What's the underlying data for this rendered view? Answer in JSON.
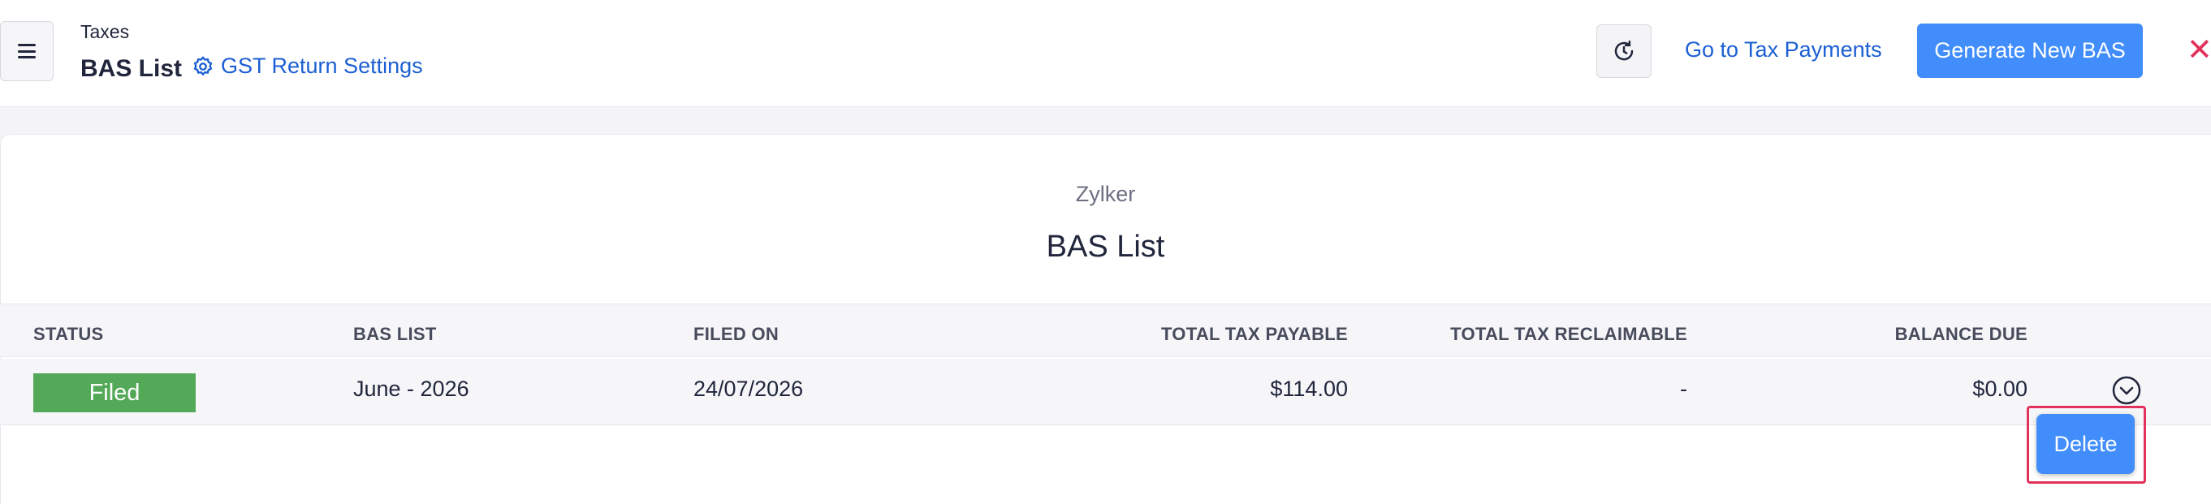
{
  "header": {
    "breadcrumb": "Taxes",
    "title": "BAS List",
    "settings_link": "GST Return Settings",
    "payments_link": "Go to Tax Payments",
    "generate_button": "Generate New BAS",
    "close_glyph": "✕",
    "icons": [
      "menu-icon",
      "gear-icon",
      "refresh-icon",
      "close-icon"
    ]
  },
  "report": {
    "organization": "Zylker",
    "title": "BAS List"
  },
  "table": {
    "columns": [
      "STATUS",
      "BAS LIST",
      "FILED ON",
      "TOTAL TAX PAYABLE",
      "TOTAL TAX RECLAIMABLE",
      "BALANCE DUE"
    ],
    "rows": [
      {
        "status": "Filed",
        "bas_list": "June - 2026",
        "filed_on": "24/07/2026",
        "total_tax_payable": "$114.00",
        "total_tax_reclaimable": "-",
        "balance_due": "$0.00"
      }
    ]
  },
  "row_menu": {
    "delete_label": "Delete"
  },
  "colors": {
    "accent": "#408dfb",
    "link": "#1b5fd3",
    "status_filed": "#53a958",
    "highlight": "#e0325b"
  }
}
